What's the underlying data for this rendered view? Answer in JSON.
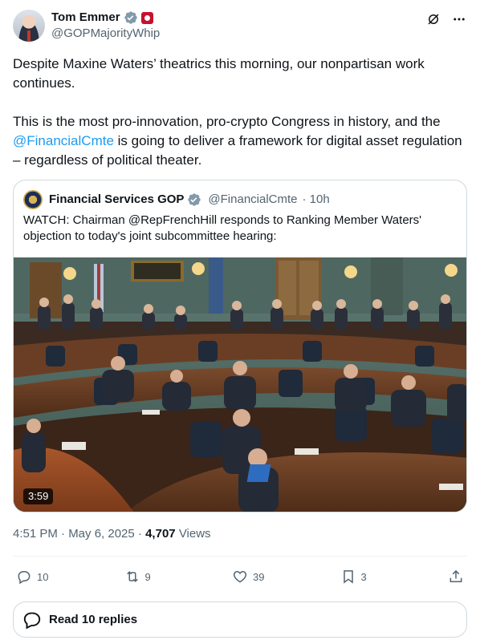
{
  "author": {
    "name": "Tom Emmer",
    "handle": "@GOPMajorityWhip"
  },
  "tweet": {
    "para1": "Despite Maxine Waters’ theatrics this morning, our nonpartisan work continues.",
    "para2_before": "This is the most pro-innovation, pro-crypto Congress in history, and the ",
    "para2_mention": "@FinancialCmte",
    "para2_after": " is going to deliver a framework for digital asset regulation – regardless of political theater."
  },
  "quote": {
    "name": "Financial Services GOP",
    "handle": "@FinancialCmte",
    "time": "· 10h",
    "text": "WATCH: Chairman @RepFrenchHill responds to Ranking Member Waters' objection to today's joint subcommittee hearing:",
    "video_duration": "3:59"
  },
  "meta": {
    "time": "4:51 PM · May 6, 2025",
    "sep": "·",
    "views_count": "4,707",
    "views_label": "Views"
  },
  "stats": {
    "replies": "10",
    "reposts": "9",
    "likes": "39",
    "bookmarks": "3"
  },
  "read_replies": "Read 10 replies",
  "colors": {
    "accent": "#1d9bf0",
    "text": "#0f1419",
    "muted": "#536471",
    "border": "#cfd9de"
  }
}
